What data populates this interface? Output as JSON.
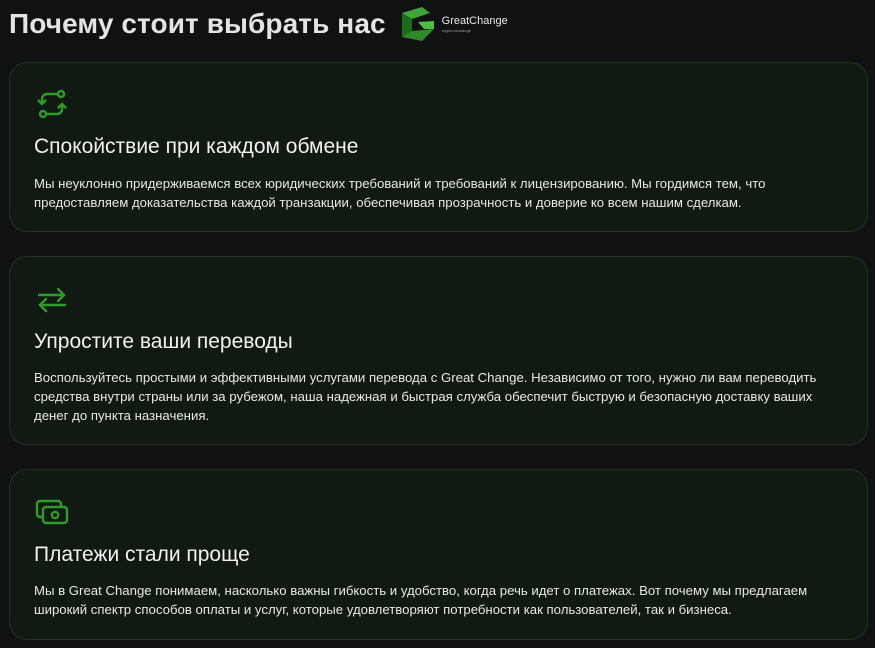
{
  "header": {
    "title": "Почему стоит выбрать нас",
    "logo": {
      "name": "GreatChange",
      "tagline": "crypto exchange",
      "accent": "#3fa53a"
    }
  },
  "colors": {
    "accent": "#2f9a2a",
    "card_bg": "#111a12",
    "page_bg": "#0f1113"
  },
  "cards": [
    {
      "icon": "refresh-arrows-icon",
      "title": "Спокойствие при каждом обмене",
      "text": "Мы неуклонно придерживаемся всех юридических требований и требований к лицензированию. Мы гордимся тем, что предоставляем доказательства каждой транзакции, обеспечивая прозрачность и доверие ко всем нашим сделкам."
    },
    {
      "icon": "transfer-arrows-icon",
      "title": "Упростите ваши переводы",
      "text": "Воспользуйтесь простыми и эффективными услугами перевода с Great Change. Независимо от того, нужно ли вам переводить средства внутри страны или за рубежом, наша надежная и быстрая служба обеспечит быструю и безопасную доставку ваших денег до пункта назначения."
    },
    {
      "icon": "banknotes-icon",
      "title": "Платежи стали проще",
      "text": "Мы в Great Change понимаем, насколько важны гибкость и удобство, когда речь идет о платежах. Вот почему мы предлагаем широкий спектр способов оплаты и услуг, которые удовлетворяют потребности как пользователей, так и бизнеса."
    }
  ]
}
